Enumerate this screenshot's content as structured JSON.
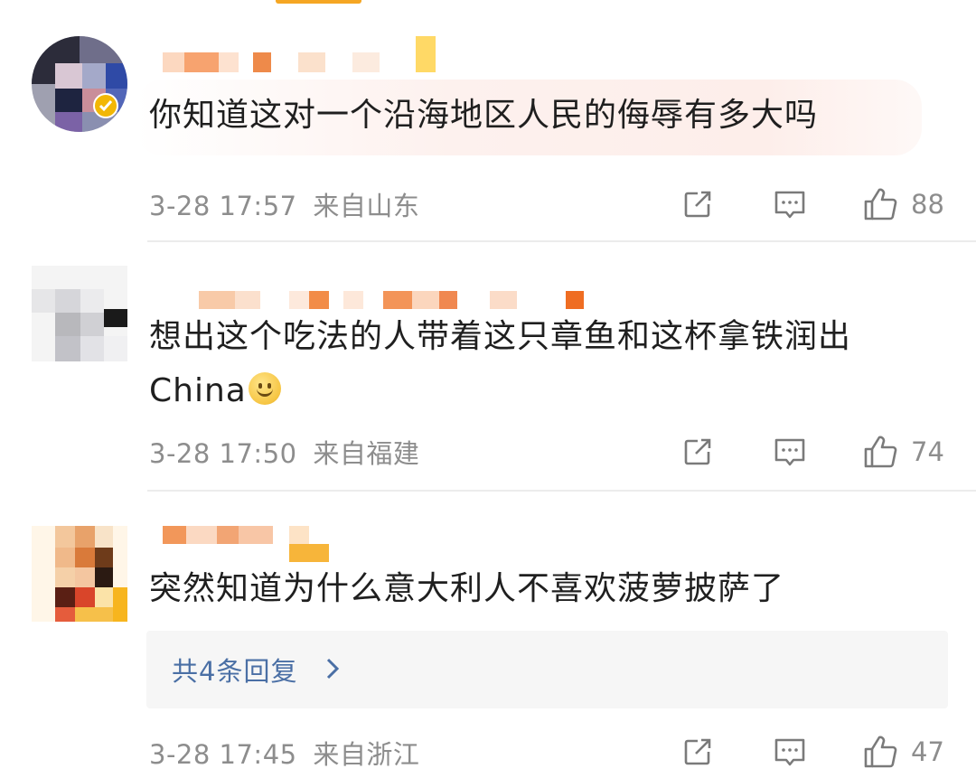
{
  "comments": [
    {
      "text": "你知道这对一个沿海地区人民的侮辱有多大吗",
      "time": "3-28 17:57",
      "location": "来自山东",
      "likes": "88"
    },
    {
      "text_line1": "想出这个吃法的人带着这只章鱼和这杯拿铁润出",
      "text_line2": "China",
      "emoji": "smile-emoji",
      "time": "3-28 17:50",
      "location": "来自福建",
      "likes": "74"
    },
    {
      "text": "突然知道为什么意大利人不喜欢菠萝披萨了",
      "replies_label": "共4条回复",
      "time": "3-28 17:45",
      "location": "来自浙江",
      "likes": "47"
    }
  ],
  "icons": {
    "share": "share-icon",
    "comment": "comment-icon",
    "like": "thumbs-up-icon",
    "chevron": "chevron-right-icon"
  },
  "colors": {
    "meta_text": "#8d8d8d",
    "link_blue": "#4a6fa5",
    "highlight": "#fdeeea",
    "reply_bg": "#f6f6f6"
  }
}
